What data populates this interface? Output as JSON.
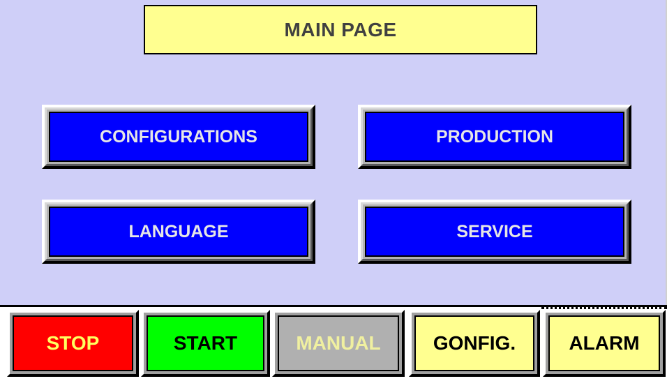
{
  "title": "MAIN PAGE",
  "menu": {
    "configurations": "CONFIGURATIONS",
    "production": "PRODUCTION",
    "language": "LANGUAGE",
    "service": "SERVICE"
  },
  "footer": {
    "stop": "STOP",
    "start": "START",
    "manual": "MANUAL",
    "config": "GONFIG.",
    "alarm": "ALARM"
  },
  "colors": {
    "background": "#cfcff8",
    "title_fill": "#ffff90",
    "menu_button": "#0000ff",
    "stop": "#ff0000",
    "start": "#00ff00",
    "manual": "#b0b0b0",
    "config": "#ffff90",
    "alarm": "#ffff90"
  }
}
